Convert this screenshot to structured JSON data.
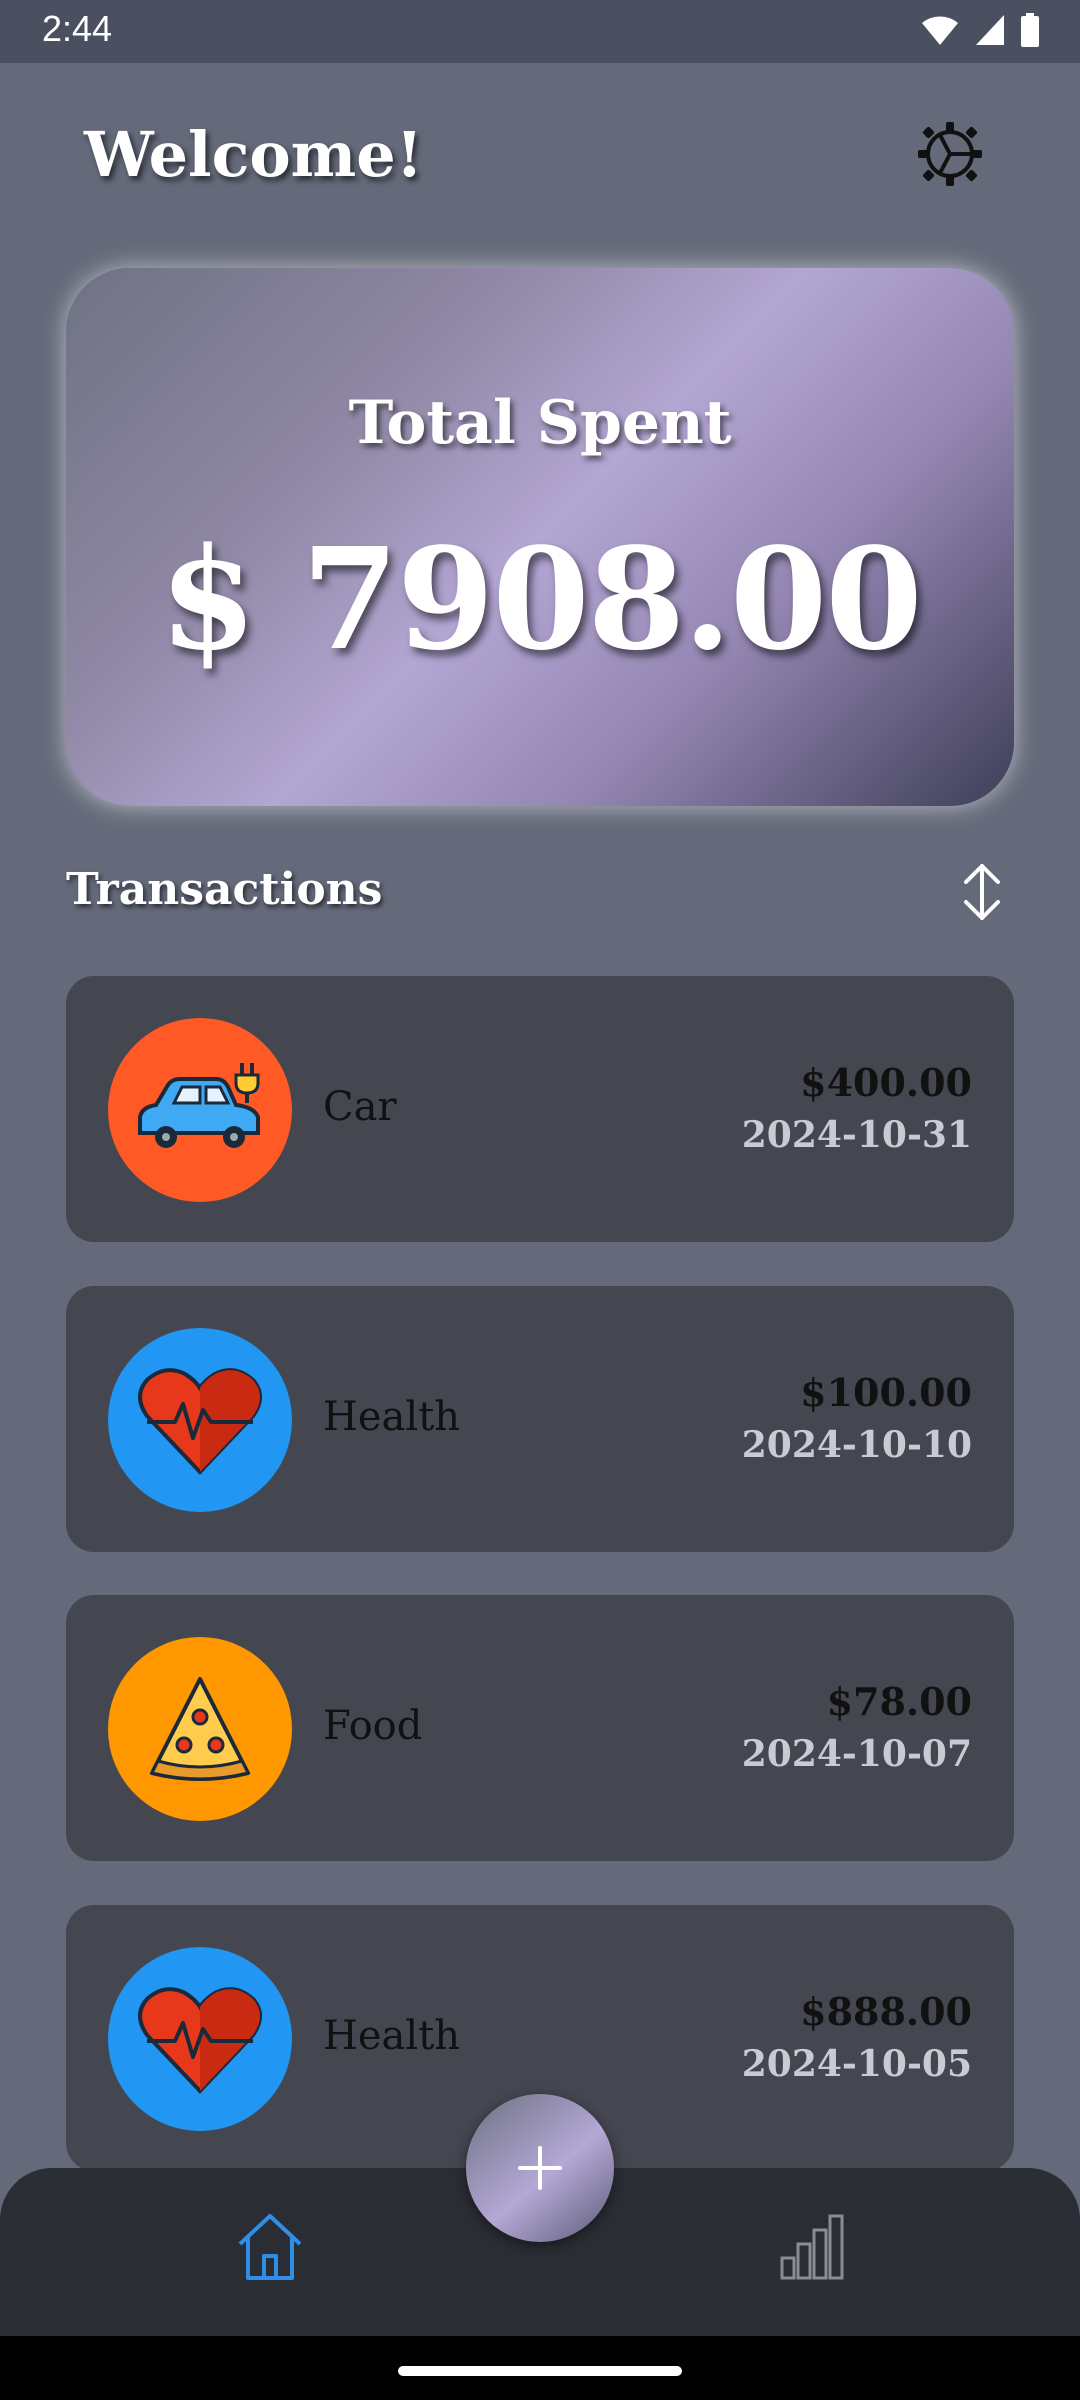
{
  "status_bar": {
    "time": "2:44",
    "icons": [
      "wifi-icon",
      "signal-icon",
      "battery-icon"
    ]
  },
  "header": {
    "title": "Welcome!",
    "settings_icon": "gear-icon"
  },
  "summary": {
    "label": "Total Spent",
    "amount": "$ 7908.00"
  },
  "transactions": {
    "title": "Transactions",
    "sort_icon": "sort-icon",
    "items": [
      {
        "category": "Car",
        "amount": "$400.00",
        "date": "2024-10-31",
        "icon": "car-icon",
        "color": "#ff5a26"
      },
      {
        "category": "Health",
        "amount": "$100.00",
        "date": "2024-10-10",
        "icon": "heart-icon",
        "color": "#2196f3"
      },
      {
        "category": "Food",
        "amount": "$78.00",
        "date": "2024-10-07",
        "icon": "pizza-icon",
        "color": "#ff9800"
      },
      {
        "category": "Health",
        "amount": "$888.00",
        "date": "2024-10-05",
        "icon": "heart-icon",
        "color": "#2196f3"
      }
    ]
  },
  "bottom_nav": {
    "items": [
      {
        "name": "home",
        "icon": "home-icon",
        "active": true,
        "color": "#2f8fe8"
      },
      {
        "name": "stats",
        "icon": "bar-chart-icon",
        "active": false,
        "color": "#8a8c95"
      }
    ],
    "fab_icon": "plus-icon"
  }
}
